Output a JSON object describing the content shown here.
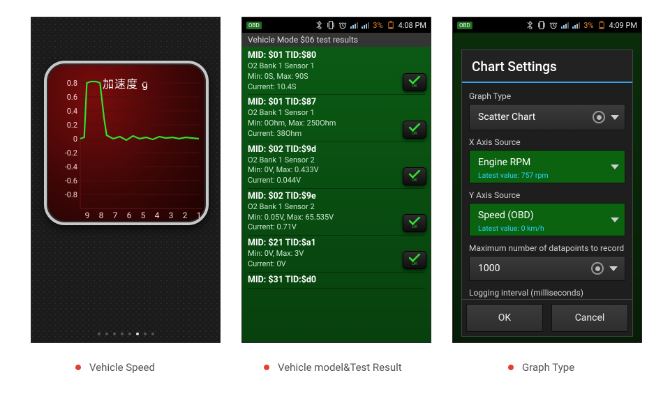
{
  "captions": {
    "c1": "Vehicle Speed",
    "c2": "Vehicle model&Test Result",
    "c3": "Graph Type"
  },
  "phone1": {
    "gauge_title": "加速度 g",
    "y_ticks": [
      "0.8",
      "0.6",
      "0.4",
      "0.2",
      "0",
      "-0.2",
      "-0.4",
      "-0.6",
      "-0.8"
    ],
    "x_ticks": [
      "9",
      "8",
      "7",
      "6",
      "5",
      "4",
      "3",
      "2",
      "1"
    ],
    "pager_count": 8,
    "pager_active": 5
  },
  "phone2": {
    "status": {
      "battery": "3%",
      "time": "4:08 PM"
    },
    "header": "Vehicle Mode $06 test results",
    "items": [
      {
        "hdr": "MID: $01 TID:$80",
        "sub1": "O2 Bank 1 Sensor 1",
        "sub2": "Min: 0S, Max: 90S",
        "sub3": "Current: 10.4S",
        "ok": true
      },
      {
        "hdr": "MID: $01 TID:$87",
        "sub1": "O2 Bank 1 Sensor 1",
        "sub2": "Min: 0Ohm, Max: 250Ohm",
        "sub3": "Current: 38Ohm",
        "ok": true
      },
      {
        "hdr": "MID: $02 TID:$9d",
        "sub1": "O2 Bank 1 Sensor 2",
        "sub2": "Min: 0V, Max: 0.433V",
        "sub3": "Current: 0.044V",
        "ok": true
      },
      {
        "hdr": "MID: $02 TID:$9e",
        "sub1": "O2 Bank 1 Sensor 2",
        "sub2": "Min: 0.05V, Max: 65.535V",
        "sub3": "Current: 0.71V",
        "ok": true
      },
      {
        "hdr": "MID: $21 TID:$a1",
        "sub1": "",
        "sub2": "Min: 0V, Max: 3V",
        "sub3": "Current: 0V",
        "ok": true
      },
      {
        "hdr": "MID: $31 TID:$d0",
        "sub1": "",
        "sub2": "",
        "sub3": "",
        "ok": false
      }
    ],
    "ok_label": "OK"
  },
  "phone3": {
    "status": {
      "battery": "3%",
      "time": "4:09 PM"
    },
    "dialog_title": "Chart Settings",
    "graph_type": {
      "label": "Graph Type",
      "value": "Scatter Chart"
    },
    "x_axis": {
      "label": "X Axis Source",
      "value": "Engine RPM",
      "latest": "Latest value: 757 rpm"
    },
    "y_axis": {
      "label": "Y Axis Source",
      "value": "Speed (OBD)",
      "latest": "Latest value: 0 km/h"
    },
    "max_points": {
      "label": "Maximum number of datapoints to record",
      "value": "1000"
    },
    "log_interval": {
      "label": "Logging interval (milliseconds)"
    },
    "buttons": {
      "ok": "OK",
      "cancel": "Cancel"
    }
  },
  "chart_data": {
    "type": "line",
    "title": "加速度 g",
    "xlabel": "",
    "ylabel": "g",
    "ylim": [
      -0.9,
      0.9
    ],
    "x": [
      9.5,
      9.2,
      9.0,
      8.7,
      8.5,
      8.3,
      8.0,
      7.7,
      7.5,
      7.2,
      7.0,
      6.5,
      6.0,
      5.5,
      5.0,
      4.5,
      4.0,
      3.5,
      3.0,
      2.5,
      2.0,
      1.5,
      1.0,
      0.5
    ],
    "y": [
      0.0,
      0.02,
      0.8,
      0.82,
      0.82,
      0.82,
      0.8,
      0.3,
      0.05,
      0.02,
      0.0,
      0.03,
      -0.02,
      0.04,
      0.0,
      0.02,
      -0.01,
      0.03,
      0.01,
      0.02,
      0.0,
      0.02,
      0.01,
      0.0
    ]
  }
}
